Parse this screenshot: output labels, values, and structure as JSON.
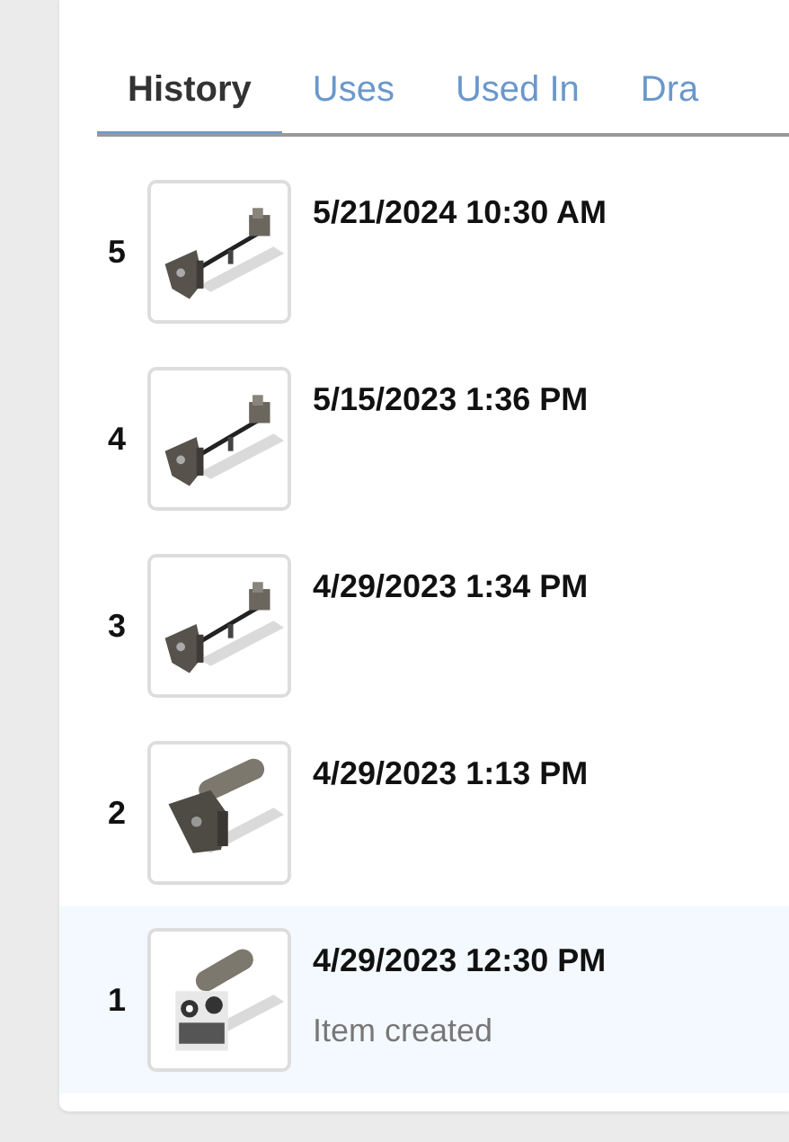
{
  "tabs": [
    {
      "label": "History",
      "selected": true
    },
    {
      "label": "Uses",
      "selected": false
    },
    {
      "label": "Used In",
      "selected": false
    },
    {
      "label": "Dra",
      "selected": false
    }
  ],
  "versions": [
    {
      "number": "5",
      "date": "5/21/2024 10:30 AM",
      "selected": false
    },
    {
      "number": "4",
      "date": "5/15/2023 1:36 PM",
      "selected": false
    },
    {
      "number": "3",
      "date": "4/29/2023 1:34 PM",
      "selected": false
    },
    {
      "number": "2",
      "date": "4/29/2023 1:13 PM",
      "selected": false
    },
    {
      "number": "1",
      "date": "4/29/2023 12:30 PM",
      "note": "Item created",
      "selected": true
    }
  ]
}
